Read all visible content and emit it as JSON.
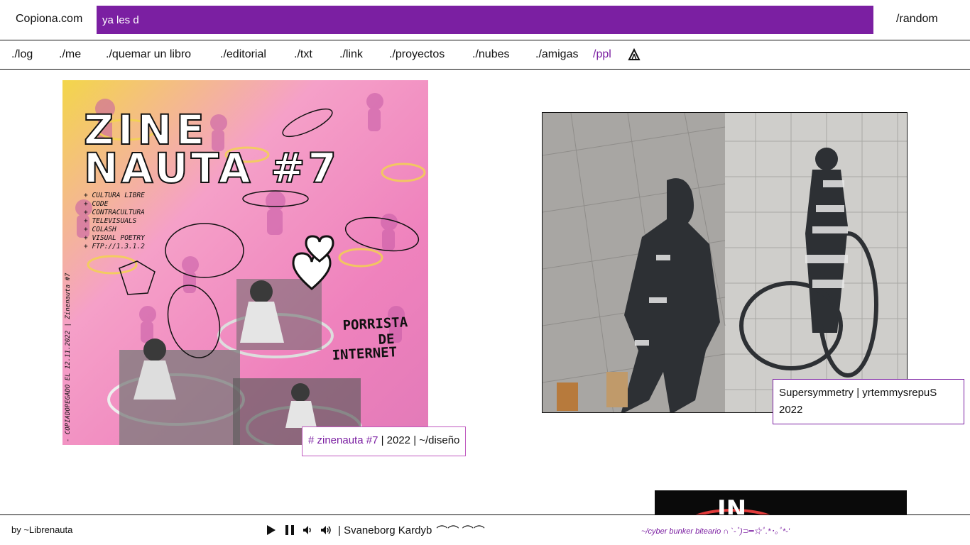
{
  "header": {
    "site_title": "Copiona.com",
    "search_value": "ya les d",
    "random_label": "/random"
  },
  "nav": {
    "items": [
      "./log",
      "./me",
      "./quemar un libro",
      "./editorial",
      "./txt",
      "./link",
      "./proyectos",
      "./nubes",
      "./amigas",
      "/ppl"
    ],
    "active_index": 9,
    "extra_icon": "tent-icon"
  },
  "posts": [
    {
      "image_title": "ZINE NAUTA #7",
      "image_topics": [
        "+ CULTURA LIBRE",
        "+ CODE",
        "+ CONTRACULTURA",
        "+ TELEVISUALS",
        "+ COLASH",
        "+ VISUAL POETRY",
        "+ FTP://1.3.1.2"
      ],
      "image_side_text": "- COPIADOPEGADO EL 12.11.2022 | Zinenauta #7",
      "image_stamp": "PORRISTA DE INTERNET",
      "tag": "# zinenauta #7",
      "meta": "| 2022 | ~/diseño"
    },
    {
      "title_line": "Supersymmetry | yrtemmysrepuS",
      "year": "2022"
    }
  ],
  "teaser": {
    "text": "IN"
  },
  "footer": {
    "byline": "by ~Librenauta",
    "track": "| Svaneborg Kardyb",
    "track_deco": "⌒⌒ ⌒⌒",
    "status": "~/cyber bunker biteario ∩ `-ﾞ)⊃━☆ﾟ.*･｡ﾟ*-'"
  },
  "colors": {
    "accent": "#7b1fa2",
    "cover_pink": "#f07ab8",
    "cover_yellow": "#f3d64a"
  }
}
